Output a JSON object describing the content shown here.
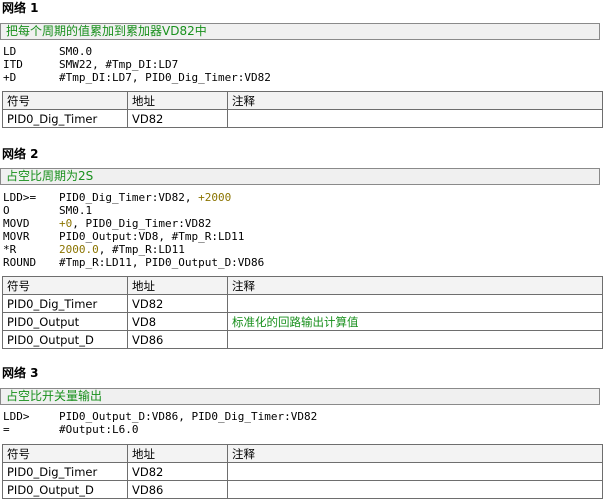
{
  "networks": [
    {
      "title": "网络 1",
      "comment": "把每个周期的值累加到累加器VD82中",
      "code": [
        {
          "op": "LD",
          "args": [
            {
              "t": "SM0.0"
            }
          ]
        },
        {
          "op": "ITD",
          "args": [
            {
              "t": "SMW22, #Tmp_DI:LD7"
            }
          ]
        },
        {
          "op": "+D",
          "args": [
            {
              "t": "#Tmp_DI:LD7, PID0_Dig_Timer:VD82"
            }
          ]
        }
      ],
      "table": {
        "headers": [
          "符号",
          "地址",
          "注释"
        ],
        "rows": [
          [
            "PID0_Dig_Timer",
            "VD82",
            ""
          ]
        ]
      }
    },
    {
      "title": "网络 2",
      "comment": "占空比周期为2S",
      "code": [
        {
          "op": "LDD>=",
          "args": [
            {
              "t": "PID0_Dig_Timer:VD82, "
            },
            {
              "t": "+2000",
              "c": true
            }
          ]
        },
        {
          "op": "O",
          "args": [
            {
              "t": "SM0.1"
            }
          ]
        },
        {
          "op": "MOVD",
          "args": [
            {
              "t": "+0",
              "c": true
            },
            {
              "t": ", PID0_Dig_Timer:VD82"
            }
          ]
        },
        {
          "op": "MOVR",
          "args": [
            {
              "t": "PID0_Output:VD8, #Tmp_R:LD11"
            }
          ]
        },
        {
          "op": "*R",
          "args": [
            {
              "t": "2000.0",
              "c": true
            },
            {
              "t": ", #Tmp_R:LD11"
            }
          ]
        },
        {
          "op": "ROUND",
          "args": [
            {
              "t": "#Tmp_R:LD11, PID0_Output_D:VD86"
            }
          ]
        }
      ],
      "table": {
        "headers": [
          "符号",
          "地址",
          "注释"
        ],
        "rows": [
          [
            "PID0_Dig_Timer",
            "VD82",
            ""
          ],
          [
            "PID0_Output",
            "VD8",
            "标准化的回路输出计算值"
          ],
          [
            "PID0_Output_D",
            "VD86",
            ""
          ]
        ]
      }
    },
    {
      "title": "网络 3",
      "comment": "占空比开关量输出",
      "code": [
        {
          "op": "LDD>",
          "args": [
            {
              "t": "PID0_Output_D:VD86, PID0_Dig_Timer:VD82"
            }
          ]
        },
        {
          "op": "=",
          "args": [
            {
              "t": "#Output:L6.0"
            }
          ]
        }
      ],
      "table": {
        "headers": [
          "符号",
          "地址",
          "注释"
        ],
        "rows": [
          [
            "PID0_Dig_Timer",
            "VD82",
            ""
          ],
          [
            "PID0_Output_D",
            "VD86",
            ""
          ]
        ]
      }
    }
  ]
}
